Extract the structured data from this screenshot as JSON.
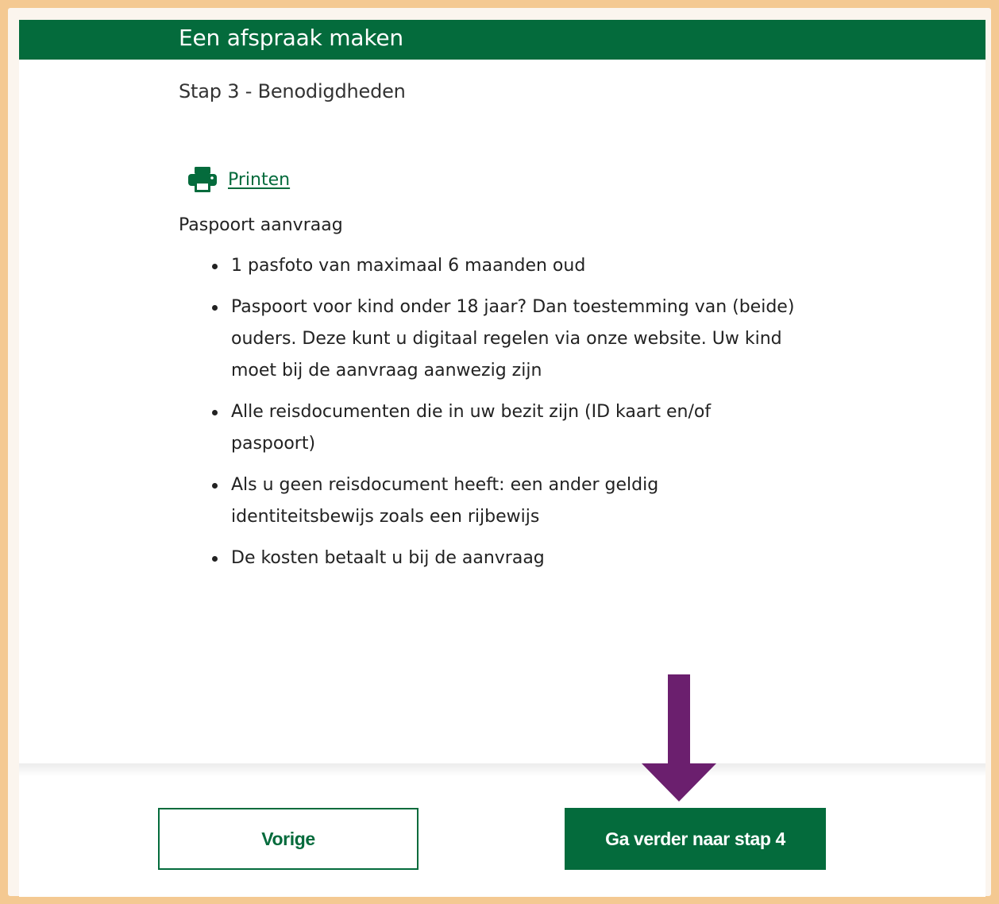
{
  "header": {
    "title": "Een afspraak maken"
  },
  "step": {
    "title": "Stap 3 - Benodigdheden"
  },
  "print": {
    "label": "Printen",
    "icon": "printer-icon"
  },
  "requirements": {
    "heading": "Paspoort aanvraag",
    "items": [
      "1 pasfoto van maximaal 6 maanden oud",
      "Paspoort voor kind onder 18 jaar? Dan toestemming van (beide) ouders. Deze kunt u digitaal regelen via onze website. Uw kind moet bij de aanvraag aanwezig zijn",
      "Alle reisdocumenten die in uw bezit zijn (ID kaart en/of paspoort)",
      "Als u geen reisdocument heeft: een ander geldig identiteitsbewijs zoals een rijbewijs",
      "De kosten betaalt u bij de aanvraag"
    ]
  },
  "footer": {
    "prev_label": "Vorige",
    "next_label": "Ga verder naar stap 4"
  },
  "colors": {
    "brand_green": "#046b3c",
    "annotation_arrow": "#6b1f6e",
    "frame_border": "#f4c992"
  }
}
